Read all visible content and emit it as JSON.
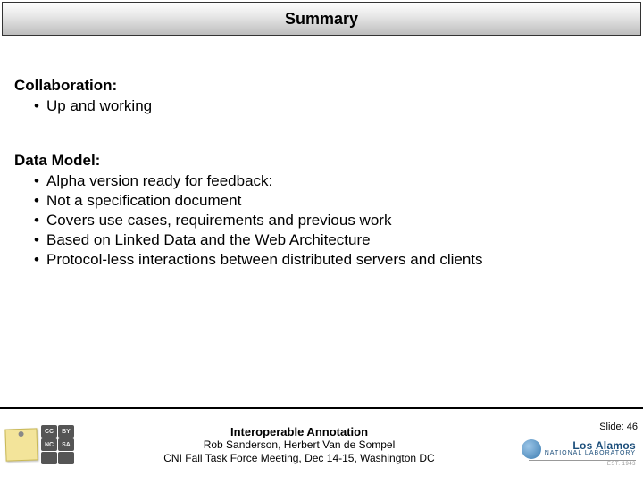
{
  "title": "Summary",
  "sections": [
    {
      "heading": "Collaboration:",
      "bullets": [
        "Up and working"
      ]
    },
    {
      "heading": "Data Model:",
      "bullets": [
        "Alpha version ready for feedback:",
        "Not a specification document",
        "Covers use cases, requirements and previous work",
        "Based on Linked Data and the Web Architecture",
        "Protocol-less interactions between distributed servers and clients"
      ]
    }
  ],
  "footer": {
    "project_title": "Interoperable Annotation",
    "authors": "Rob Sanderson, Herbert Van de Sompel",
    "event": "CNI Fall Task Force Meeting, Dec 14-15, Washington DC",
    "slide_label": "Slide: 46",
    "cc": [
      "CC",
      "BY",
      "NC",
      "SA",
      "",
      ""
    ],
    "lanl": {
      "name": "Los Alamos",
      "sub": "NATIONAL LABORATORY",
      "est": "EST. 1943"
    }
  }
}
